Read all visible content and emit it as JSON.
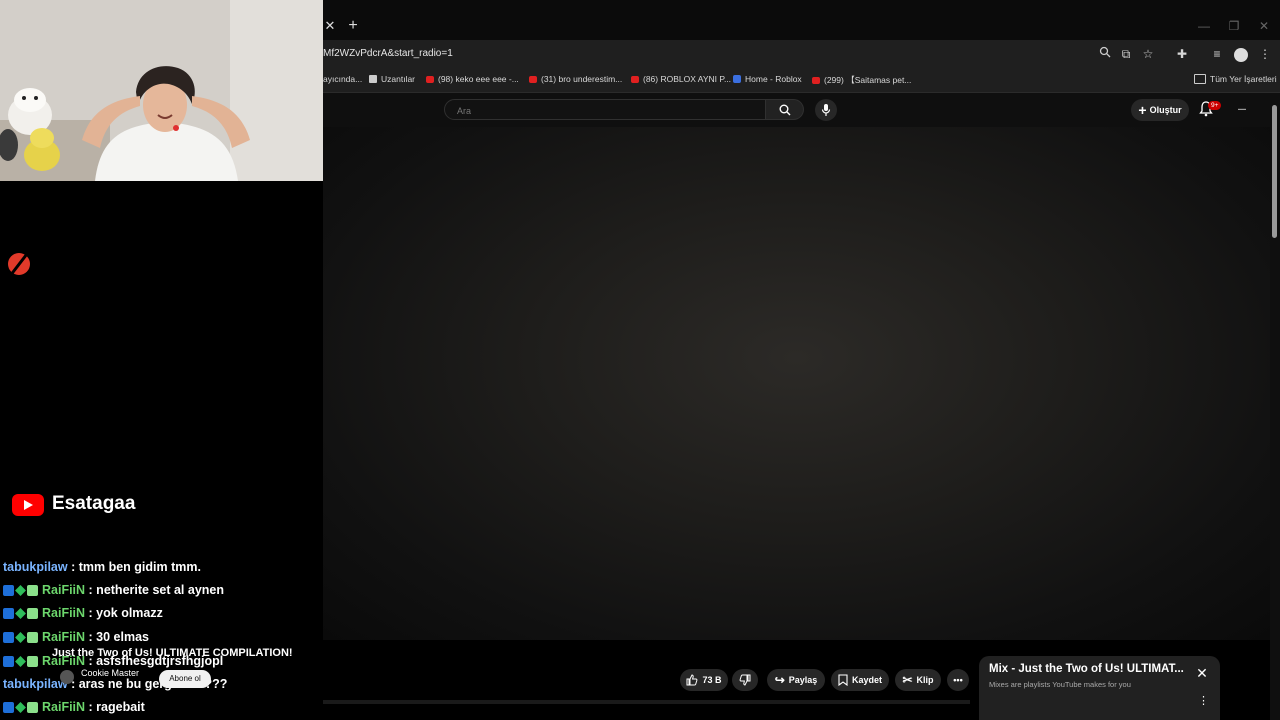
{
  "browser": {
    "url": "Mf2WZvPdcrA&start_radio=1",
    "bookmarks": [
      {
        "label": "ayıcında...",
        "icon": "none"
      },
      {
        "label": "Uzantılar",
        "icon": "puzzle-icon"
      },
      {
        "label": "(98) keko eee eee -...",
        "icon": "youtube-icon"
      },
      {
        "label": "(31) bro underestim...",
        "icon": "youtube-icon"
      },
      {
        "label": "(86) ROBLOX AYNI P...",
        "icon": "youtube-icon"
      },
      {
        "label": "Home - Roblox",
        "icon": "roblox-icon"
      },
      {
        "label": "(299) 【Saitamas pet...",
        "icon": "youtube-icon"
      }
    ],
    "all_bookmarks": "Tüm Yer İşaretleri"
  },
  "youtube": {
    "search_placeholder": "Ara",
    "create_label": "Oluştur",
    "notification_count": "9+",
    "like_count": "73 B",
    "share_label": "Paylaş",
    "save_label": "Kaydet",
    "clip_label": "Klip",
    "video_title_overlay": "Just the Two of Us! ULTIMATE COMPILATION!",
    "uploader": "Cookie Master",
    "subscribe_partial": "Abone ol",
    "mix": {
      "title": "Mix - Just the Two of Us! ULTIMAT...",
      "subtitle": "Mixes are playlists YouTube makes for you"
    }
  },
  "stream": {
    "channel_name": "Esatagaa",
    "chat": [
      {
        "user": "tabukpilaw",
        "message": ": tmm ben gidim tmm.",
        "color": "#7ab4ff",
        "badges": false
      },
      {
        "user": "RaiFiiN",
        "message": ": netherite set al aynen",
        "color": "#6cd66c",
        "badges": true
      },
      {
        "user": "RaiFiiN",
        "message": ": yok olmazz",
        "color": "#6cd66c",
        "badges": true
      },
      {
        "user": "RaiFiiN",
        "message": ": 30 elmas",
        "color": "#6cd66c",
        "badges": true
      },
      {
        "user": "RaiFiiN",
        "message": ": asfsfhesgdtjrsfhgjopl",
        "color": "#6cd66c",
        "badges": true
      },
      {
        "user": "tabukpilaw",
        "message": ": aras ne bu gerginlik????",
        "color": "#7ab4ff",
        "badges": false
      },
      {
        "user": "RaiFiiN",
        "message": ": ragebait",
        "color": "#6cd66c",
        "badges": true
      }
    ]
  }
}
